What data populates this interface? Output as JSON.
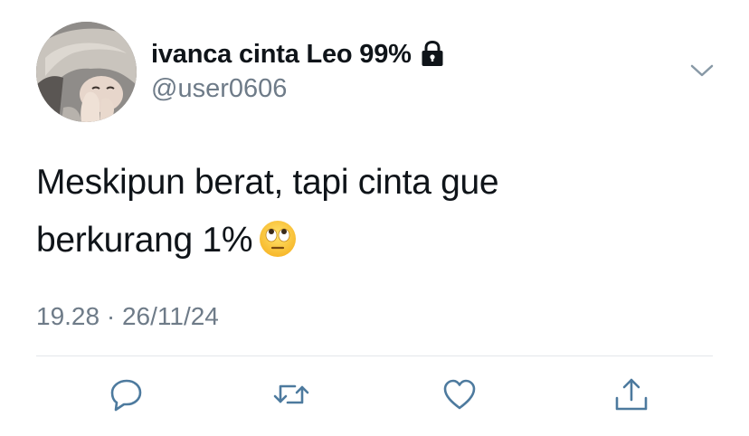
{
  "tweet": {
    "author": {
      "display_name": "ivanca cinta Leo 99%",
      "handle": "@user0606",
      "avatar_icon": "profile-photo",
      "locked_icon": "lock-icon"
    },
    "text_lines": [
      "Meskipun berat, tapi cinta gue",
      "berkurang 1%"
    ],
    "emoji": "face-with-rolling-eyes",
    "time": "19.28",
    "separator": "·",
    "date": "26/11/24"
  },
  "actions": {
    "icons": [
      "reply-icon",
      "retweet-icon",
      "like-icon",
      "share-icon"
    ]
  },
  "colors": {
    "text": "#0f1419",
    "secondary": "#6e7b88",
    "icon": "#4d7a9e",
    "divider": "#e3e7ea"
  }
}
